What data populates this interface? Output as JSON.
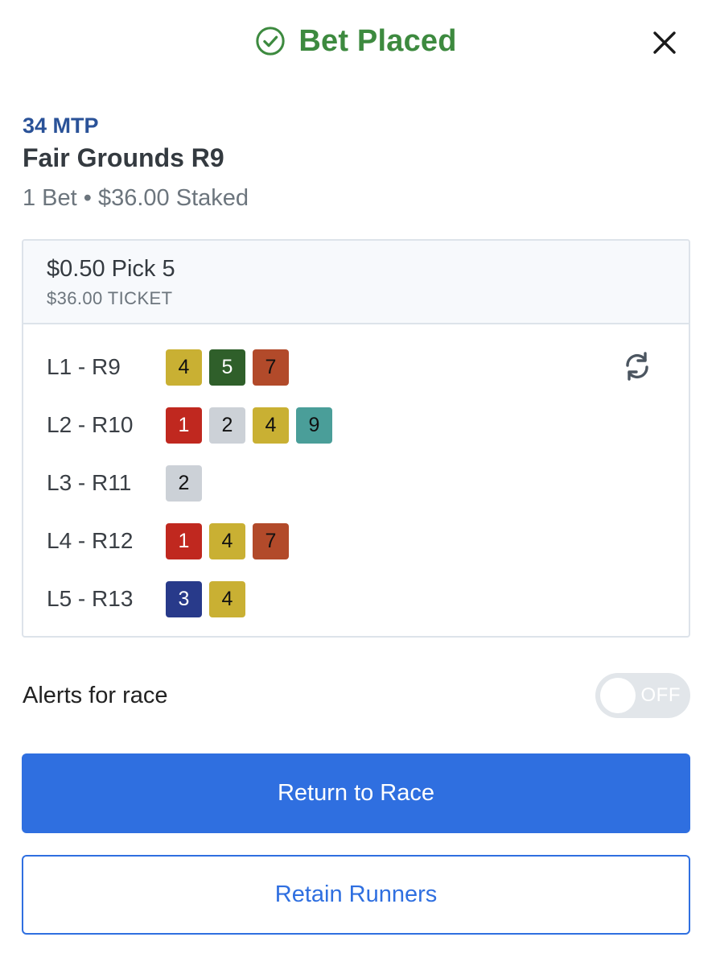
{
  "header": {
    "title": "Bet Placed",
    "check_icon": "check-circle-icon",
    "close_icon": "close-icon",
    "title_color": "#3d8a3f"
  },
  "race": {
    "mtp": "34 MTP",
    "name": "Fair Grounds R9",
    "summary": "1 Bet • $36.00 Staked"
  },
  "ticket": {
    "bet_type": "$0.50 Pick 5",
    "cost": "$36.00 TICKET",
    "refresh_icon": "refresh-icon",
    "legs": [
      {
        "label": "L1 - R9",
        "runners": [
          {
            "number": "4",
            "color": "#c9b033",
            "text": "dark"
          },
          {
            "number": "5",
            "color": "#2f5f2a",
            "text": "light"
          },
          {
            "number": "7",
            "color": "#b24a2a",
            "text": "dark"
          }
        ]
      },
      {
        "label": "L2 - R10",
        "runners": [
          {
            "number": "1",
            "color": "#c0281f",
            "text": "light"
          },
          {
            "number": "2",
            "color": "#ccd1d7",
            "text": "dark"
          },
          {
            "number": "4",
            "color": "#c9b033",
            "text": "dark"
          },
          {
            "number": "9",
            "color": "#4a9e99",
            "text": "dark"
          }
        ]
      },
      {
        "label": "L3 - R11",
        "runners": [
          {
            "number": "2",
            "color": "#ccd1d7",
            "text": "dark"
          }
        ]
      },
      {
        "label": "L4 - R12",
        "runners": [
          {
            "number": "1",
            "color": "#c0281f",
            "text": "light"
          },
          {
            "number": "4",
            "color": "#c9b033",
            "text": "dark"
          },
          {
            "number": "7",
            "color": "#b24a2a",
            "text": "dark"
          }
        ]
      },
      {
        "label": "L5 - R13",
        "runners": [
          {
            "number": "3",
            "color": "#283a8a",
            "text": "light"
          },
          {
            "number": "4",
            "color": "#c9b033",
            "text": "dark"
          }
        ]
      }
    ]
  },
  "alerts": {
    "label": "Alerts for race",
    "toggle_state": "OFF"
  },
  "actions": {
    "primary_label": "Return to Race",
    "secondary_label": "Retain Runners",
    "accent_color": "#2f6fe0"
  }
}
